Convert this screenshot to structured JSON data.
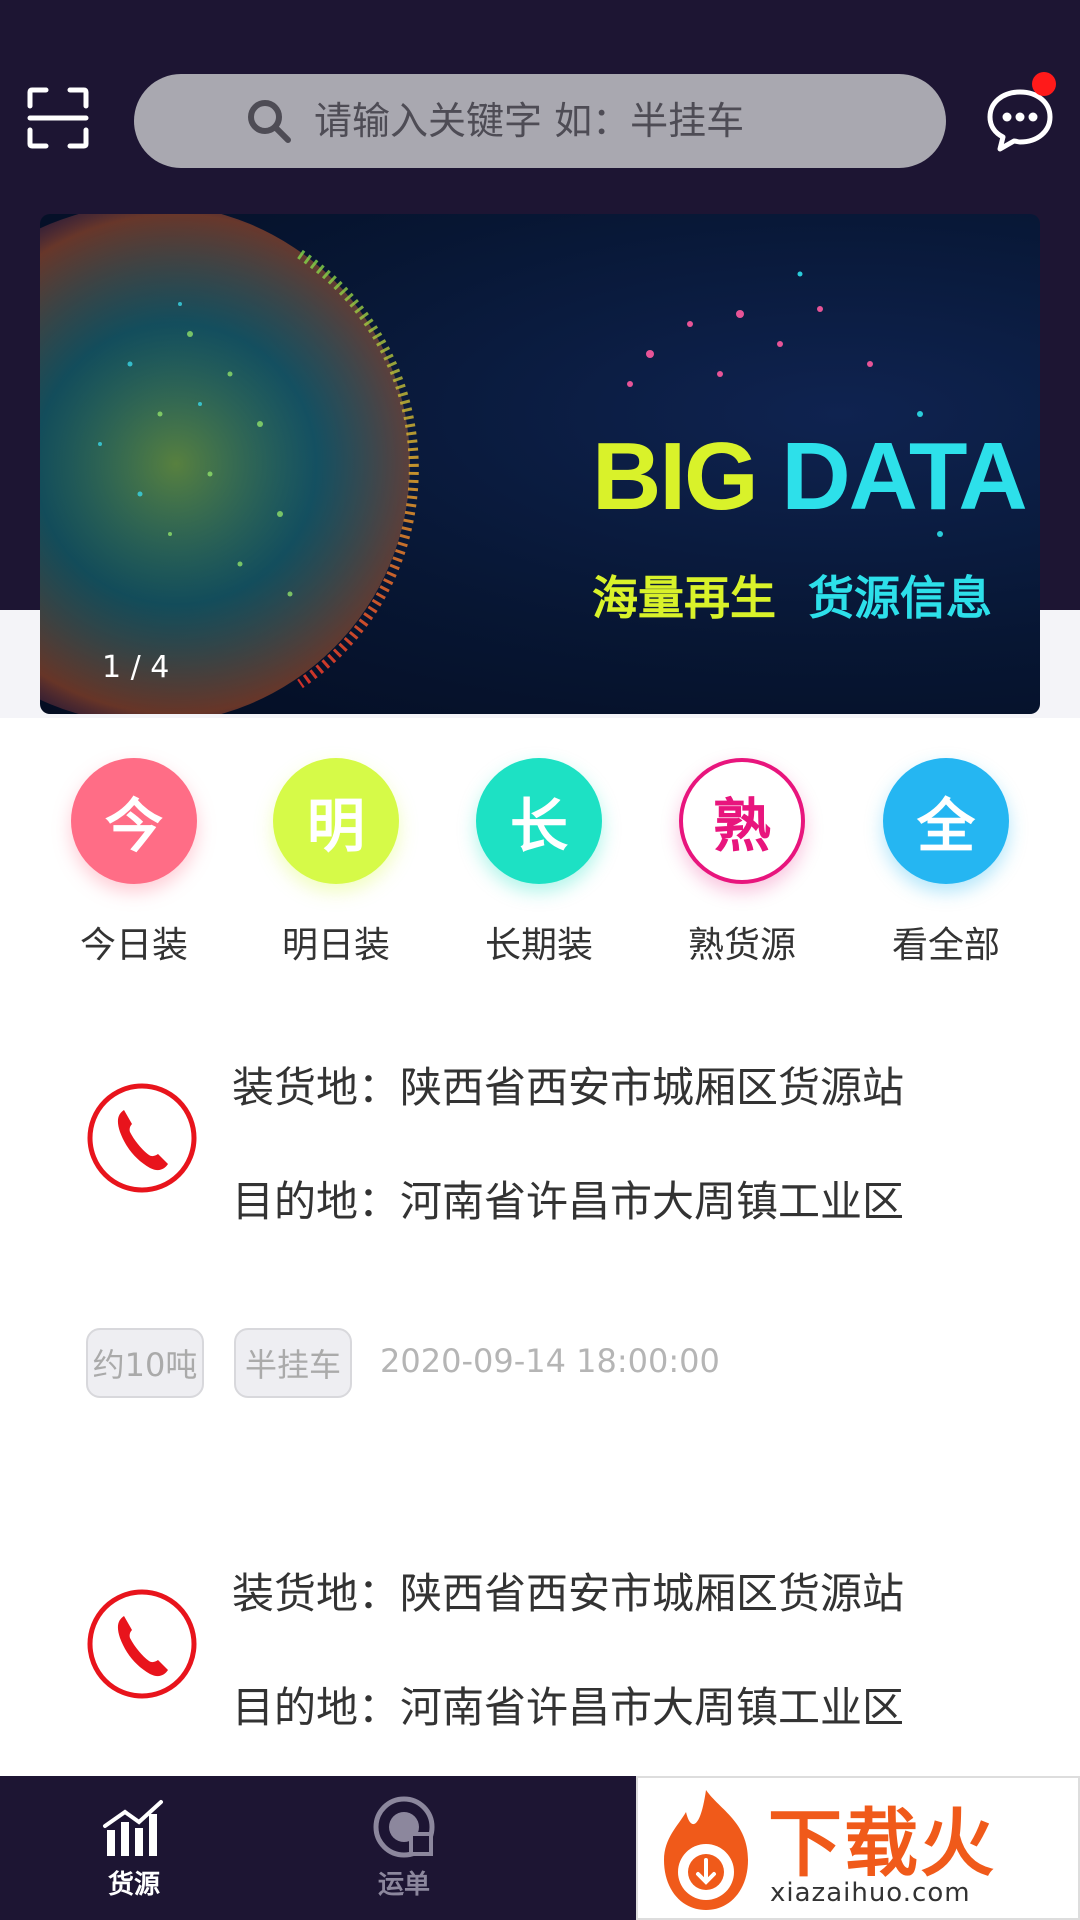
{
  "search": {
    "placeholder": "请输入关键字 如：半挂车"
  },
  "banner": {
    "title_part1": "BIG",
    "title_part2": "DATA",
    "subtitle_left": "海量再生",
    "subtitle_right": "货源信息",
    "counter": "1 / 4"
  },
  "quick_entries": [
    {
      "glyph": "今",
      "label": "今日装",
      "color": "#ff6d86"
    },
    {
      "glyph": "明",
      "label": "明日装",
      "color": "#d6fa48"
    },
    {
      "glyph": "长",
      "label": "长期装",
      "color": "#1de1c4"
    },
    {
      "glyph": "熟",
      "label": "熟货源",
      "color": "#e8157d"
    },
    {
      "glyph": "全",
      "label": "看全部",
      "color": "#25b6f2"
    }
  ],
  "cargo_list": [
    {
      "loading": "装货地：陕西省西安市城厢区货源站",
      "destination": "目的地：河南省许昌市大周镇工业区",
      "tags": [
        "约10吨",
        "半挂车"
      ],
      "time": "2020-09-14 18:00:00"
    },
    {
      "loading": "装货地：陕西省西安市城厢区货源站",
      "destination": "目的地：河南省许昌市大周镇工业区"
    }
  ],
  "bottom_nav": [
    {
      "label": "货源",
      "icon": "chart-bars-icon"
    },
    {
      "label": "运单",
      "icon": "order-icon"
    }
  ],
  "watermark": {
    "text": "下载火",
    "url": "xiazaihuo.com"
  },
  "colors": {
    "header_bg": "#1d1533",
    "accent_red": "#ff1a1a"
  }
}
